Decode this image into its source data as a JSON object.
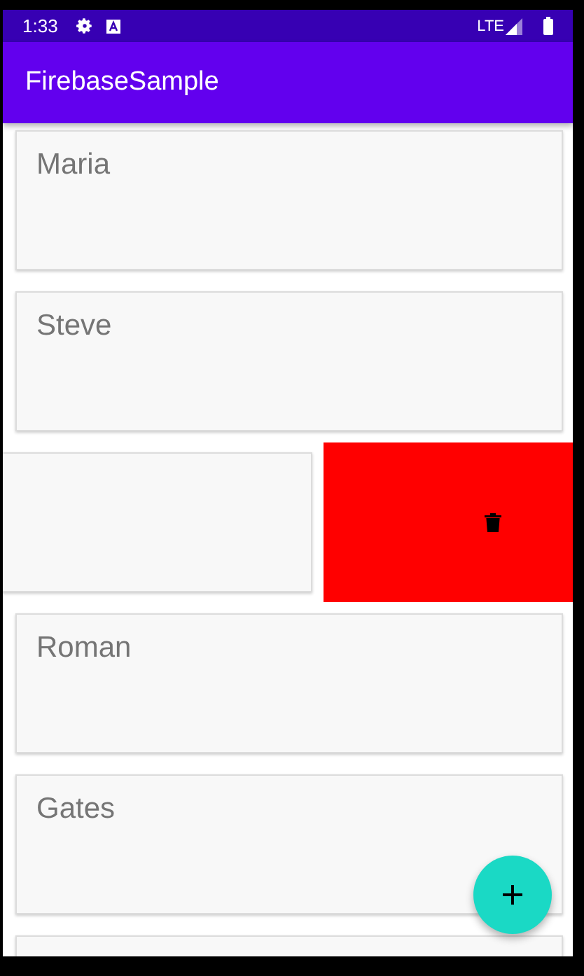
{
  "status_bar": {
    "time": "1:33",
    "network": "LTE"
  },
  "app_bar": {
    "title": "FirebaseSample"
  },
  "items": [
    {
      "name": "Maria",
      "swiped": false
    },
    {
      "name": "Steve",
      "swiped": false
    },
    {
      "swiped": true
    },
    {
      "name": "Roman",
      "swiped": false
    },
    {
      "name": "Gates",
      "swiped": false
    },
    {
      "swiped": false
    }
  ],
  "fab": {
    "kind": "add"
  }
}
